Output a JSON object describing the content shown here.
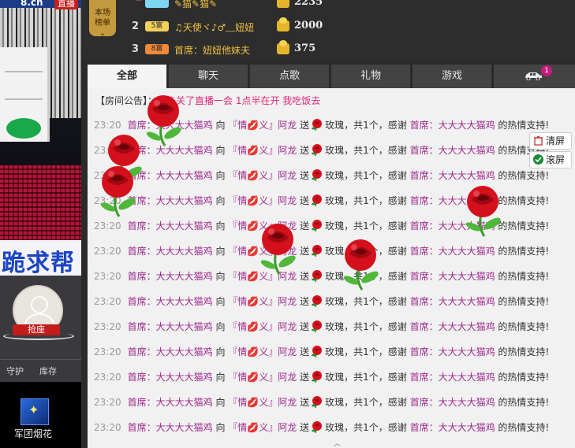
{
  "left_panel": {
    "logo_text": "8.cn",
    "live_tag": "直播",
    "banner_text": "跪求帮",
    "grab_seat_label": "抢座",
    "tabs": [
      "守护",
      "库存"
    ],
    "gift_label": "军团烟花"
  },
  "rank_board": {
    "badge_line1": "本场",
    "badge_line2": "榜单",
    "rows": [
      {
        "rank": "",
        "level": "",
        "name": "✎猫✎猫✎",
        "score": "2235",
        "level_color": "#7ed6f0"
      },
      {
        "rank": "2",
        "level": "5富",
        "name": "♫天使ヾ♪♂﹏妞妞",
        "score": "2000",
        "level_color": "#f2d05a"
      },
      {
        "rank": "3",
        "level": "8富",
        "name": "首席：妞妞他妹夫",
        "score": "375",
        "level_color": "#f08a3a"
      }
    ]
  },
  "tabs": [
    "全部",
    "聊天",
    "点歌",
    "礼物",
    "游戏"
  ],
  "car_badge_count": "1",
  "chat": {
    "notice_label": "【房间公告】：",
    "notice_text": "我先关了直播一会 1点半在开 我吃饭去",
    "side_buttons": {
      "clear": "清屏",
      "scroll": "滚屏"
    },
    "messages": [
      {
        "time": "23:20",
        "sender": "首席：大大大大猫鸡",
        "to": "向",
        "target": "『情💋义』阿龙",
        "send": "送",
        "gift": "玫瑰",
        "rest": "，共1个，感谢",
        "thanks_to": "首席：大大大大猫鸡",
        "tail": "的热情支持!"
      },
      {
        "time": "23:20",
        "sender": "首席：大大大大猫鸡",
        "to": "向",
        "target": "『情💋义』阿龙",
        "send": "送",
        "gift": "玫瑰",
        "rest": "，共1个，感谢",
        "thanks_to": "首席：大大大大猫鸡",
        "tail": "的热情支持!"
      },
      {
        "time": "23:20",
        "sender": "首席：大大大大猫鸡",
        "to": "向",
        "target": "『情💋义』阿龙",
        "send": "送",
        "gift": "玫瑰",
        "rest": "，共1个，感谢",
        "thanks_to": "首席：大大大大猫鸡",
        "tail": "的热情支持!"
      },
      {
        "time": "23:20",
        "sender": "首席：大大大大猫鸡",
        "to": "向",
        "target": "『情💋义』阿龙",
        "send": "送",
        "gift": "玫瑰",
        "rest": "，共1个，感谢",
        "thanks_to": "首席：大大大大猫鸡",
        "tail": "的热情支持!"
      },
      {
        "time": "23:20",
        "sender": "首席：大大大大猫鸡",
        "to": "向",
        "target": "『情💋义』阿龙",
        "send": "送",
        "gift": "玫瑰",
        "rest": "，共1个，感谢",
        "thanks_to": "首席：大大大大猫鸡",
        "tail": "的热情支持!"
      },
      {
        "time": "23:20",
        "sender": "首席：大大大大猫鸡",
        "to": "向",
        "target": "『情💋义』阿龙",
        "send": "送",
        "gift": "玫瑰",
        "rest": "，共1个，感谢",
        "thanks_to": "首席：大大大大猫鸡",
        "tail": "的热情支持!"
      },
      {
        "time": "23:20",
        "sender": "首席：大大大大猫鸡",
        "to": "向",
        "target": "『情💋义』阿龙",
        "send": "送",
        "gift": "玫瑰",
        "rest": "，共1个，感谢",
        "thanks_to": "首席：大大大大猫鸡",
        "tail": "的热情支持!"
      },
      {
        "time": "23:20",
        "sender": "首席：大大大大猫鸡",
        "to": "向",
        "target": "『情💋义』阿龙",
        "send": "送",
        "gift": "玫瑰",
        "rest": "，共1个，感谢",
        "thanks_to": "首席：大大大大猫鸡",
        "tail": "的热情支持!"
      },
      {
        "time": "23:20",
        "sender": "首席：大大大大猫鸡",
        "to": "向",
        "target": "『情💋义』阿龙",
        "send": "送",
        "gift": "玫瑰",
        "rest": "，共1个，感谢",
        "thanks_to": "首席：大大大大猫鸡",
        "tail": "的热情支持!"
      },
      {
        "time": "23:20",
        "sender": "首席：大大大大猫鸡",
        "to": "向",
        "target": "『情💋义』阿龙",
        "send": "送",
        "gift": "玫瑰",
        "rest": "，共1个，感谢",
        "thanks_to": "首席：大大大大猫鸡",
        "tail": "的热情支持!"
      },
      {
        "time": "23:20",
        "sender": "首席：大大大大猫鸡",
        "to": "向",
        "target": "『情💋义』阿龙",
        "send": "送",
        "gift": "玫瑰",
        "rest": "，共1个，感谢",
        "thanks_to": "首席：大大大大猫鸡",
        "tail": "的热情支持!"
      },
      {
        "time": "23:20",
        "sender": "首席：大大大大猫鸡",
        "to": "向",
        "target": "『情💋义』阿龙",
        "send": "送",
        "gift": "玫瑰",
        "rest": "，共1个，感谢",
        "thanks_to": "首席：大大大大猫鸡",
        "tail": "的热情支持!"
      },
      {
        "time": "23:20",
        "sender": "首席：大大大大猫鸡",
        "to": "向",
        "target": "『情💋义』阿龙",
        "send": "送",
        "gift": "玫瑰",
        "rest": "，共1个，感谢",
        "thanks_to": "首席：大大大大猫鸡",
        "tail": "的热情支持!"
      }
    ]
  },
  "colors": {
    "accent": "#a02a8e",
    "notice": "#e0287a",
    "rose": "#d4101c"
  }
}
